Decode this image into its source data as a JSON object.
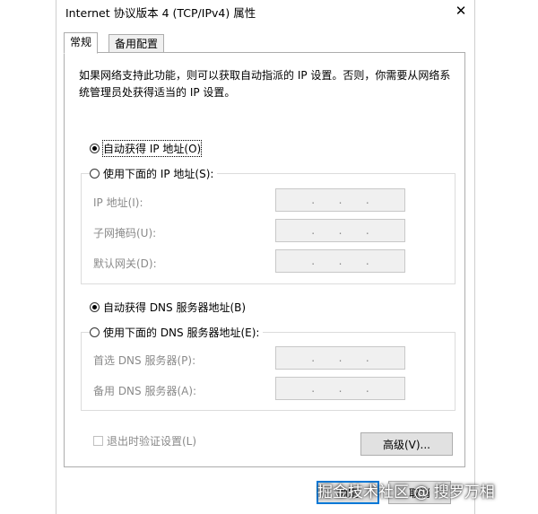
{
  "window": {
    "title": "Internet 协议版本 4 (TCP/IPv4) 属性",
    "close_symbol": "✕"
  },
  "tabs": [
    {
      "label": "常规",
      "active": true
    },
    {
      "label": "备用配置",
      "active": false
    }
  ],
  "description": "如果网络支持此功能，则可以获取自动指派的 IP 设置。否则，你需要从网络系统管理员处获得适当的 IP 设置。",
  "ip_section": {
    "auto_option": "自动获得 IP 地址(O)",
    "manual_option": "使用下面的 IP 地址(S):",
    "auto_selected": true,
    "fields": [
      {
        "label": "IP 地址(I):",
        "value": ".    .    ."
      },
      {
        "label": "子网掩码(U):",
        "value": ".    .    ."
      },
      {
        "label": "默认网关(D):",
        "value": ".    .    ."
      }
    ]
  },
  "dns_section": {
    "auto_option": "自动获得 DNS 服务器地址(B)",
    "manual_option": "使用下面的 DNS 服务器地址(E):",
    "auto_selected": true,
    "fields": [
      {
        "label": "首选 DNS 服务器(P):",
        "value": ".    .    ."
      },
      {
        "label": "备用 DNS 服务器(A):",
        "value": ".    .    ."
      }
    ]
  },
  "validate_on_exit": {
    "label": "退出时验证设置(L)",
    "checked": false
  },
  "buttons": {
    "advanced": "高级(V)...",
    "ok": "确定",
    "cancel": "取消"
  },
  "watermark": "掘金技术社区 @ 搜罗万相"
}
